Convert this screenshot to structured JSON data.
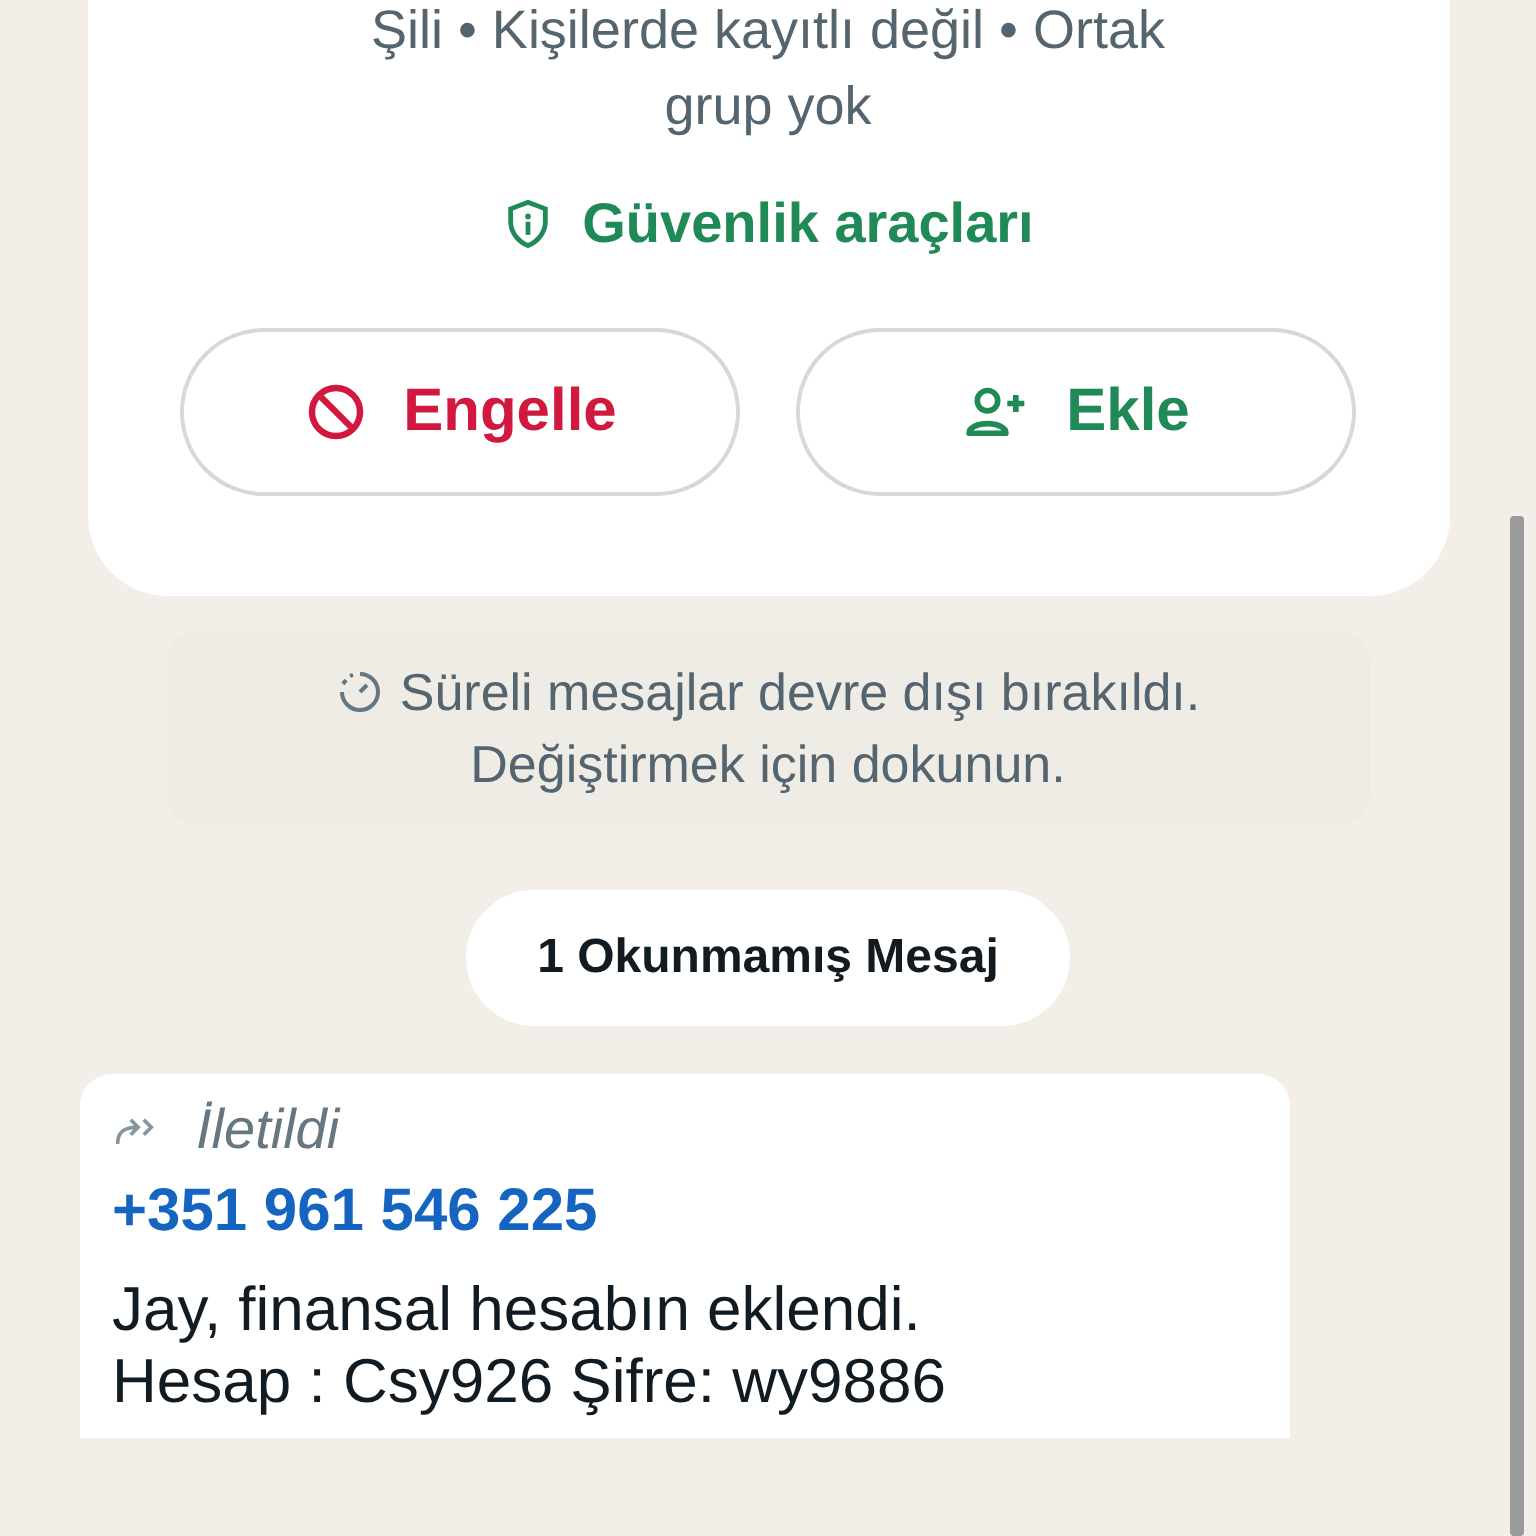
{
  "contact_card": {
    "info_lines": [
      "Şili • Kişilerde kayıtlı değil • Ortak",
      "grup yok"
    ],
    "safety_link": "Güvenlik araçları",
    "buttons": [
      {
        "kind": "block",
        "label": "Engelle"
      },
      {
        "kind": "add",
        "label": "Ekle"
      }
    ]
  },
  "system_notice": [
    "Süreli mesajlar devre dışı bırakıldı.",
    "Değiştirmek için dokunun."
  ],
  "unread_divider": "1 Okunmamış Mesaj",
  "message": {
    "forwarded": "İletildi",
    "sender": "+351 961 546 225",
    "lines": [
      "Jay, finansal hesabın eklendi.",
      "Hesap : Csy926 Şifre: wy9886"
    ]
  }
}
